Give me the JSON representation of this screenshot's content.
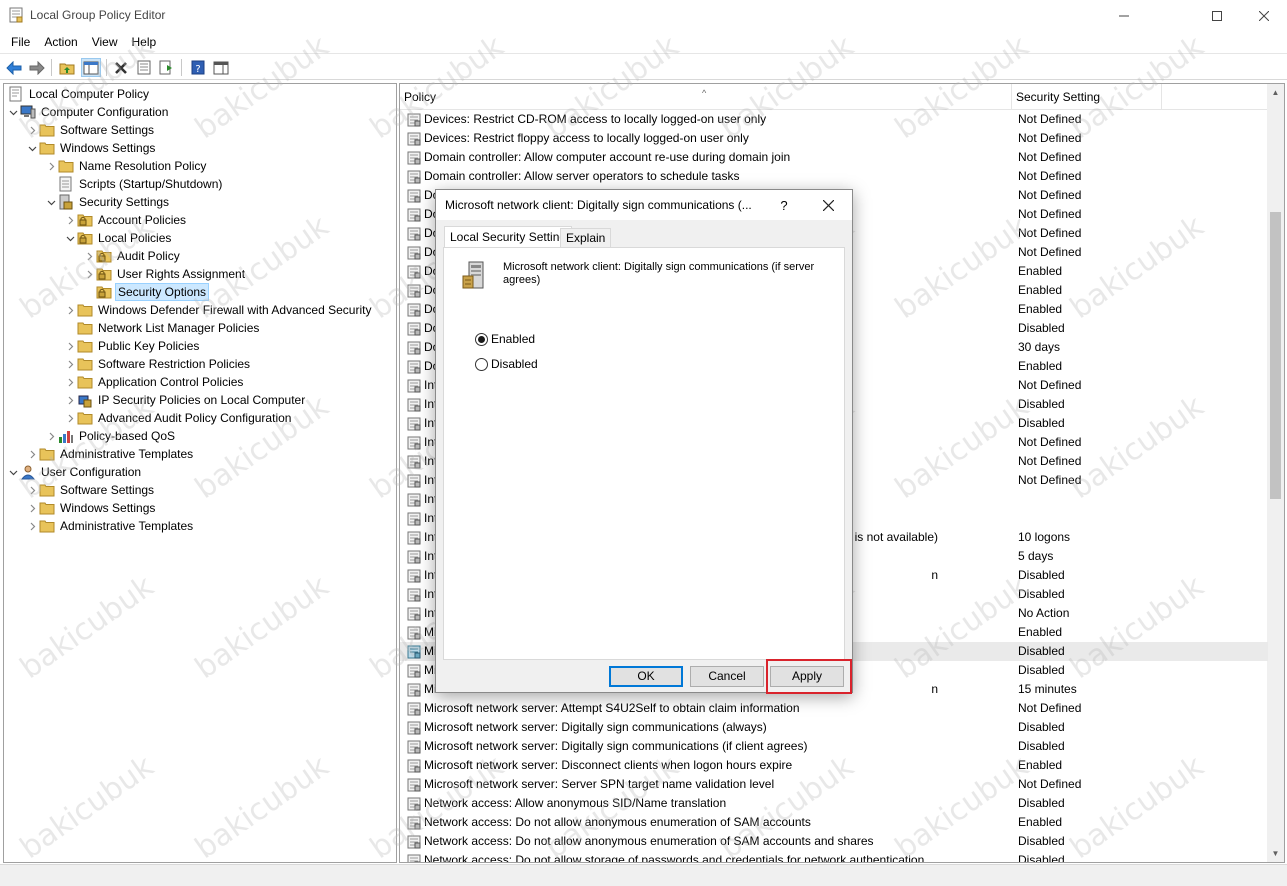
{
  "window": {
    "title": "Local Group Policy Editor"
  },
  "menu": [
    "File",
    "Action",
    "View",
    "Help"
  ],
  "tree": [
    {
      "label": "Local Computer Policy",
      "level": 0,
      "chev": "",
      "icon": "computer-policy"
    },
    {
      "label": "Computer Configuration",
      "level": 1,
      "chev": "open",
      "icon": "computer"
    },
    {
      "label": "Software Settings",
      "level": 2,
      "chev": "closed",
      "icon": "folder"
    },
    {
      "label": "Windows Settings",
      "level": 2,
      "chev": "open",
      "icon": "folder"
    },
    {
      "label": "Name Resolution Policy",
      "level": 3,
      "chev": "closed",
      "icon": "folder"
    },
    {
      "label": "Scripts (Startup/Shutdown)",
      "level": 3,
      "chev": "",
      "icon": "script"
    },
    {
      "label": "Security Settings",
      "level": 3,
      "chev": "open",
      "icon": "security"
    },
    {
      "label": "Account Policies",
      "level": 4,
      "chev": "closed",
      "icon": "lock-folder"
    },
    {
      "label": "Local Policies",
      "level": 4,
      "chev": "open",
      "icon": "lock-folder"
    },
    {
      "label": "Audit Policy",
      "level": 5,
      "chev": "closed",
      "icon": "lock-folder"
    },
    {
      "label": "User Rights Assignment",
      "level": 5,
      "chev": "closed",
      "icon": "lock-folder"
    },
    {
      "label": "Security Options",
      "level": 5,
      "chev": "",
      "icon": "lock-folder",
      "selected": true
    },
    {
      "label": "Windows Defender Firewall with Advanced Security",
      "level": 4,
      "chev": "closed",
      "icon": "folder"
    },
    {
      "label": "Network List Manager Policies",
      "level": 4,
      "chev": "",
      "icon": "folder"
    },
    {
      "label": "Public Key Policies",
      "level": 4,
      "chev": "closed",
      "icon": "folder"
    },
    {
      "label": "Software Restriction Policies",
      "level": 4,
      "chev": "closed",
      "icon": "folder"
    },
    {
      "label": "Application Control Policies",
      "level": 4,
      "chev": "closed",
      "icon": "folder"
    },
    {
      "label": "IP Security Policies on Local Computer",
      "level": 4,
      "chev": "closed",
      "icon": "ipsec"
    },
    {
      "label": "Advanced Audit Policy Configuration",
      "level": 4,
      "chev": "closed",
      "icon": "folder"
    },
    {
      "label": "Policy-based QoS",
      "level": 3,
      "chev": "closed",
      "icon": "qos"
    },
    {
      "label": "Administrative Templates",
      "level": 2,
      "chev": "closed",
      "icon": "folder"
    },
    {
      "label": "User Configuration",
      "level": 1,
      "chev": "open",
      "icon": "user"
    },
    {
      "label": "Software Settings",
      "level": 2,
      "chev": "closed",
      "icon": "folder"
    },
    {
      "label": "Windows Settings",
      "level": 2,
      "chev": "closed",
      "icon": "folder"
    },
    {
      "label": "Administrative Templates",
      "level": 2,
      "chev": "closed",
      "icon": "folder"
    }
  ],
  "list": {
    "columns": {
      "policy": "Policy",
      "setting": "Security Setting"
    },
    "rows": [
      {
        "policy": "Devices: Restrict CD-ROM access to locally logged-on user only",
        "setting": "Not Defined"
      },
      {
        "policy": "Devices: Restrict floppy access to locally logged-on user only",
        "setting": "Not Defined"
      },
      {
        "policy": "Domain controller: Allow computer account re-use during domain join",
        "setting": "Not Defined"
      },
      {
        "policy": "Domain controller: Allow server operators to schedule tasks",
        "setting": "Not Defined"
      },
      {
        "policy": "Do",
        "setting": "Not Defined"
      },
      {
        "policy": "Do",
        "setting": "Not Defined"
      },
      {
        "policy": "Do",
        "setting": "Not Defined"
      },
      {
        "policy": "Do",
        "setting": "Not Defined"
      },
      {
        "policy": "Do",
        "setting": "Enabled"
      },
      {
        "policy": "Do",
        "setting": "Enabled"
      },
      {
        "policy": "Do",
        "setting": "Enabled"
      },
      {
        "policy": "Do",
        "setting": "Disabled"
      },
      {
        "policy": "Do",
        "setting": "30 days"
      },
      {
        "policy": "Do",
        "setting": "Enabled"
      },
      {
        "policy": "Int",
        "setting": "Not Defined"
      },
      {
        "policy": "Int",
        "setting": "Disabled"
      },
      {
        "policy": "Int",
        "setting": "Disabled"
      },
      {
        "policy": "Int",
        "setting": "Not Defined"
      },
      {
        "policy": "Int",
        "setting": "Not Defined"
      },
      {
        "policy": "Int",
        "setting": "Not Defined"
      },
      {
        "policy": "Int",
        "setting": ""
      },
      {
        "policy": "Int",
        "setting": ""
      },
      {
        "policy": "Int",
        "setting": "10 logons",
        "suffix": "r is not available)"
      },
      {
        "policy": "Int",
        "setting": "5 days"
      },
      {
        "policy": "Int",
        "setting": "Disabled",
        "suffix": "n"
      },
      {
        "policy": "Int",
        "setting": "Disabled"
      },
      {
        "policy": "Int",
        "setting": "No Action"
      },
      {
        "policy": "Mi",
        "setting": "Enabled"
      },
      {
        "policy": "Mi",
        "setting": "Disabled",
        "highlight": true
      },
      {
        "policy": "Mi",
        "setting": "Disabled"
      },
      {
        "policy": "Mi",
        "setting": "15 minutes",
        "suffix": "n"
      },
      {
        "policy": "Microsoft network server: Attempt S4U2Self to obtain claim information",
        "setting": "Not Defined"
      },
      {
        "policy": "Microsoft network server: Digitally sign communications (always)",
        "setting": "Disabled"
      },
      {
        "policy": "Microsoft network server: Digitally sign communications (if client agrees)",
        "setting": "Disabled"
      },
      {
        "policy": "Microsoft network server: Disconnect clients when logon hours expire",
        "setting": "Enabled"
      },
      {
        "policy": "Microsoft network server: Server SPN target name validation level",
        "setting": "Not Defined"
      },
      {
        "policy": "Network access: Allow anonymous SID/Name translation",
        "setting": "Disabled"
      },
      {
        "policy": "Network access: Do not allow anonymous enumeration of SAM accounts",
        "setting": "Enabled"
      },
      {
        "policy": "Network access: Do not allow anonymous enumeration of SAM accounts and shares",
        "setting": "Disabled"
      },
      {
        "policy": "Network access: Do not allow storage of passwords and credentials for network authentication",
        "setting": "Disabled"
      }
    ]
  },
  "dialog": {
    "title": "Microsoft network client: Digitally sign communications (...",
    "help": "?",
    "tabs": [
      "Local Security Setting",
      "Explain"
    ],
    "description": "Microsoft network client: Digitally sign communications (if server agrees)",
    "options": [
      {
        "label": "Enabled",
        "checked": true
      },
      {
        "label": "Disabled",
        "checked": false
      }
    ],
    "buttons": {
      "ok": "OK",
      "cancel": "Cancel",
      "apply": "Apply"
    }
  },
  "watermark": "bakicubuk",
  "colors": {
    "selection": "#cce8ff",
    "accent": "#0078d7",
    "highlight_box": "#d9232c",
    "folder": "#e8c35a"
  }
}
